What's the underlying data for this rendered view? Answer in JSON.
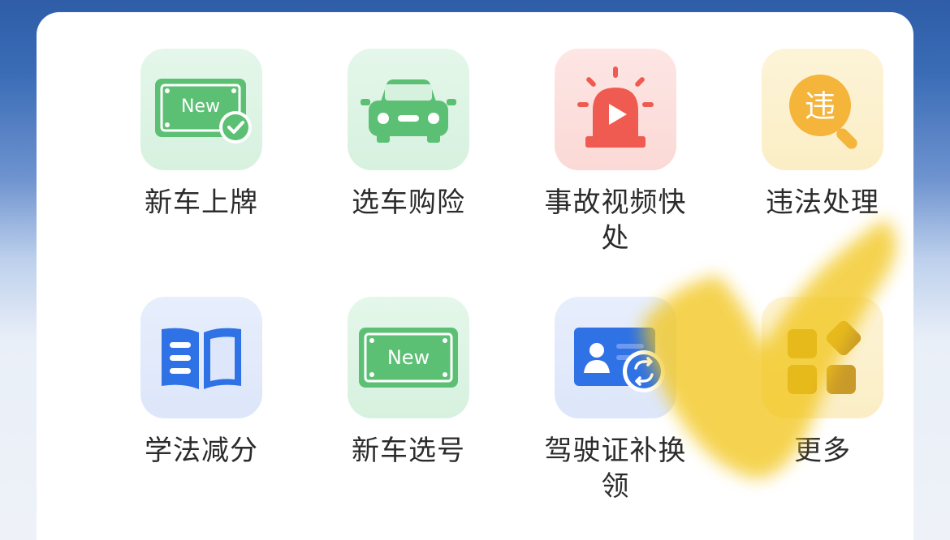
{
  "services": [
    {
      "label": "新车上牌",
      "icon": "new-plate-check-icon"
    },
    {
      "label": "选车购险",
      "icon": "car-icon"
    },
    {
      "label": "事故视频快处",
      "icon": "alarm-video-icon"
    },
    {
      "label": "违法处理",
      "icon": "violation-search-icon",
      "badge": "违"
    },
    {
      "label": "学法减分",
      "icon": "book-icon"
    },
    {
      "label": "新车选号",
      "icon": "new-plate-icon"
    },
    {
      "label": "驾驶证补换领",
      "icon": "license-exchange-icon"
    },
    {
      "label": "更多",
      "icon": "more-grid-icon"
    }
  ],
  "plate_text": "New",
  "colors": {
    "green": "#5cc074",
    "red": "#ef5b50",
    "yellow": "#f5b43a",
    "blue": "#2f72e6",
    "highlight": "#f2c512"
  }
}
